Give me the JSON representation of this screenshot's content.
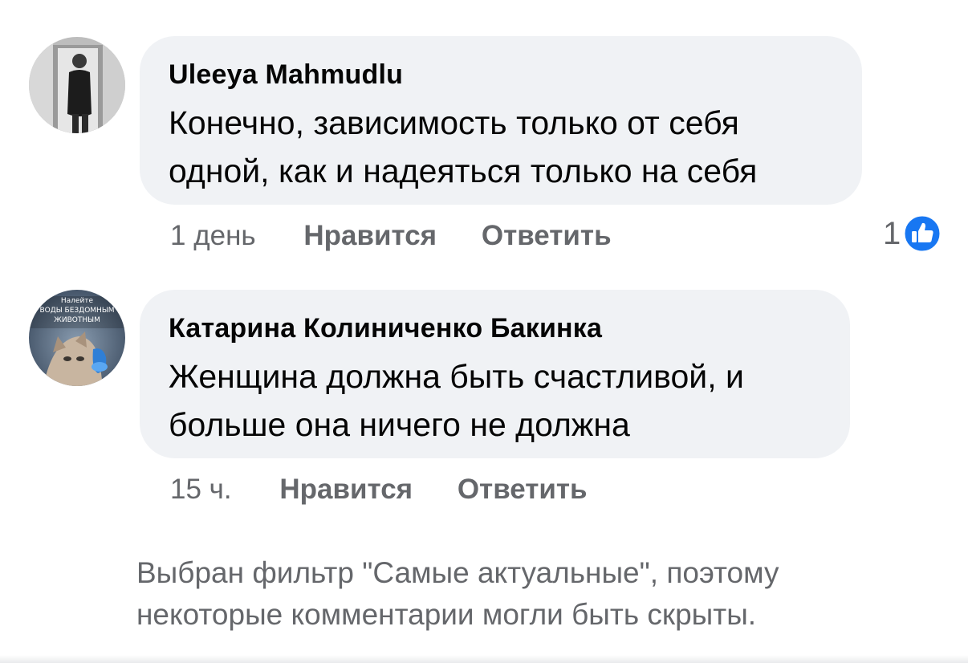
{
  "comments": [
    {
      "author": "Uleeya Mahmudlu",
      "text_lines": [
        "Конечно, зависимость только от себя",
        "одной, как и надеяться только на себя"
      ],
      "time": "1 день",
      "like_label": "Нравится",
      "reply_label": "Ответить",
      "reaction_count": "1",
      "avatar_icon": "person-photo-avatar"
    },
    {
      "author": "Катарина Колиниченко Бакинка",
      "text_lines": [
        "Женщина должна быть счастливой, и",
        "больше она ничего не должна"
      ],
      "time": "15 ч.",
      "like_label": "Нравится",
      "reply_label": "Ответить",
      "avatar_icon": "cat-photo-avatar",
      "avatar_text": [
        "Налейте",
        "воды бездомным",
        "животным"
      ]
    }
  ],
  "notice_lines": [
    "Выбран фильтр \"Самые актуальные\", поэтому",
    "некоторые комментарии могли быть скрыты."
  ],
  "colors": {
    "bubble": "#f0f2f5",
    "secondary_text": "#65676b",
    "like_blue": "#1877f2"
  }
}
